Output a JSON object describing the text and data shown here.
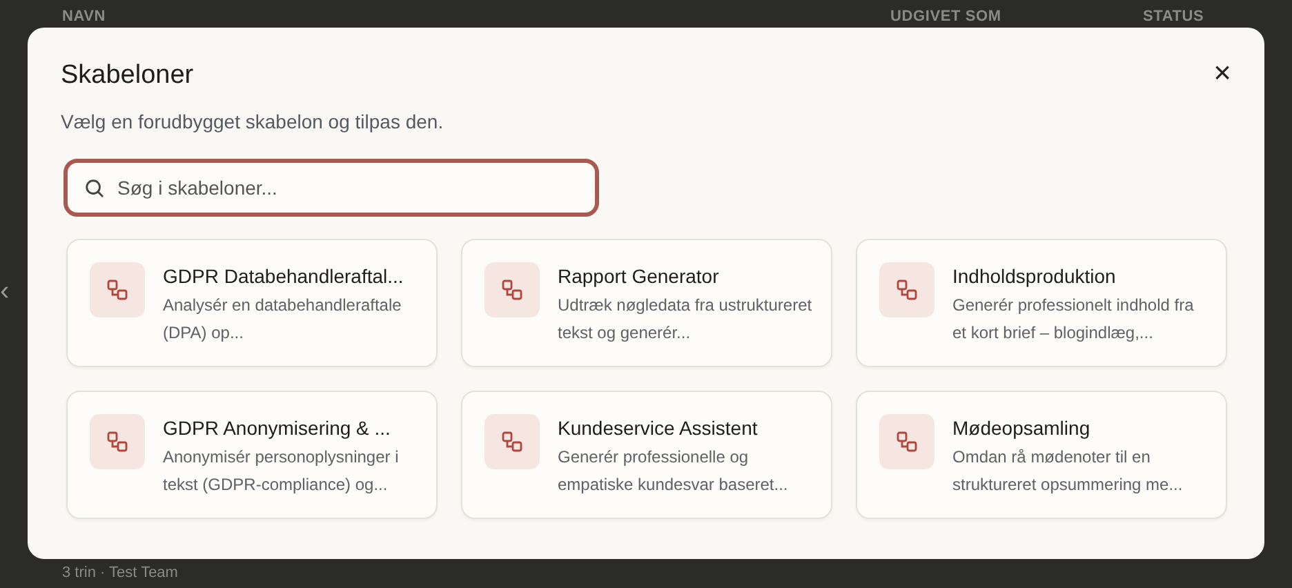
{
  "background": {
    "columns": [
      "NAVN",
      "UDGIVET SOM",
      "STATUS"
    ],
    "row_meta": "3 trin · Test Team",
    "side_arrow": "‹"
  },
  "dialog": {
    "title": "Skabeloner",
    "subtitle": "Vælg en forudbygget skabelon og tilpas den.",
    "close": "×",
    "search": {
      "placeholder": "Søg i skabeloner..."
    },
    "templates": [
      {
        "title": "GDPR Databehandleraftal...",
        "description": "Analysér en databehandleraftale (DPA) op..."
      },
      {
        "title": "Rapport Generator",
        "description": "Udtræk nøgledata fra ustruktureret tekst og generér..."
      },
      {
        "title": "Indholdsproduktion",
        "description": "Generér professionelt indhold fra et kort brief – blogindlæg,..."
      },
      {
        "title": "GDPR Anonymisering & ...",
        "description": "Anonymisér personoplysninger i tekst (GDPR-compliance) og..."
      },
      {
        "title": "Kundeservice Assistent",
        "description": "Generér professionelle og empatiske kundesvar baseret..."
      },
      {
        "title": "Mødeopsamling",
        "description": "Omdan rå mødenoter til en struktureret opsummering me..."
      }
    ]
  }
}
